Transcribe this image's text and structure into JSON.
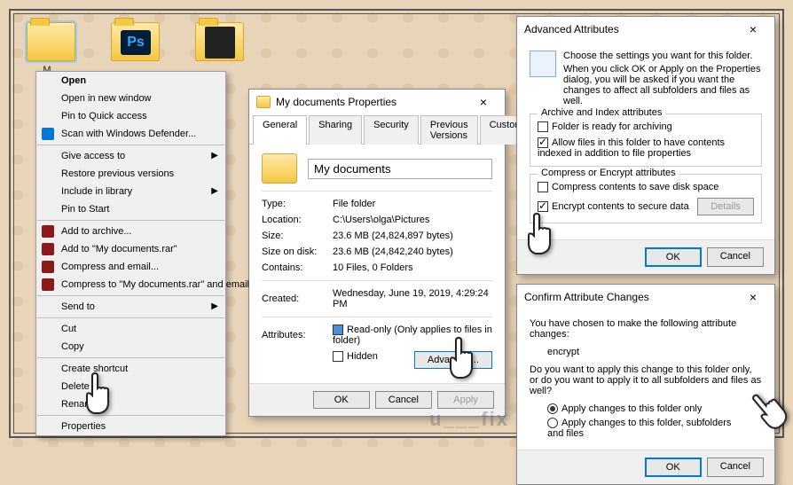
{
  "folders": [
    {
      "label": "M..."
    },
    {
      "label": ""
    },
    {
      "label": ""
    }
  ],
  "context_menu": {
    "open": "Open",
    "open_new_window": "Open in new window",
    "pin_quick": "Pin to Quick access",
    "scan_defender": "Scan with Windows Defender...",
    "give_access": "Give access to",
    "restore": "Restore previous versions",
    "include": "Include in library",
    "pin_start": "Pin to Start",
    "add_archive": "Add to archive...",
    "add_rar": "Add to \"My documents.rar\"",
    "compress_email": "Compress and email...",
    "compress_rar_email": "Compress to \"My documents.rar\" and email",
    "send_to": "Send to",
    "cut": "Cut",
    "copy": "Copy",
    "shortcut": "Create shortcut",
    "delete": "Delete",
    "rename": "Rename",
    "properties": "Properties"
  },
  "properties": {
    "title": "My documents Properties",
    "tabs": {
      "general": "General",
      "sharing": "Sharing",
      "security": "Security",
      "prev": "Previous Versions",
      "customize": "Customize"
    },
    "name": "My documents",
    "type_label": "Type:",
    "type": "File folder",
    "location_label": "Location:",
    "location": "C:\\Users\\olga\\Pictures",
    "size_label": "Size:",
    "size": "23.6 MB (24,824,897 bytes)",
    "sizeon_label": "Size on disk:",
    "sizeon": "23.6 MB (24,842,240 bytes)",
    "contains_label": "Contains:",
    "contains": "10 Files, 0 Folders",
    "created_label": "Created:",
    "created": "Wednesday, June 19, 2019, 4:29:24 PM",
    "attr_label": "Attributes:",
    "readonly": "Read-only (Only applies to files in folder)",
    "hidden": "Hidden",
    "advanced": "Advanced...",
    "ok": "OK",
    "cancel": "Cancel",
    "apply": "Apply"
  },
  "advanced": {
    "title": "Advanced Attributes",
    "desc1": "Choose the settings you want for this folder.",
    "desc2": "When you click OK or Apply on the Properties dialog, you will be asked if you want the changes to affect all subfolders and files as well.",
    "group1": "Archive and Index attributes",
    "archive": "Folder is ready for archiving",
    "index": "Allow files in this folder to have contents indexed in addition to file properties",
    "group2": "Compress or Encrypt attributes",
    "compress": "Compress contents to save disk space",
    "encrypt": "Encrypt contents to secure data",
    "details": "Details",
    "ok": "OK",
    "cancel": "Cancel"
  },
  "confirm": {
    "title": "Confirm Attribute Changes",
    "line1": "You have chosen to make the following attribute changes:",
    "attr": "encrypt",
    "line2": "Do you want to apply this change to this folder only, or do you want to apply it to all subfolders and files as well?",
    "opt1": "Apply changes to this folder only",
    "opt2": "Apply changes to this folder, subfolders and files",
    "ok": "OK",
    "cancel": "Cancel"
  },
  "watermark": "u___fix"
}
